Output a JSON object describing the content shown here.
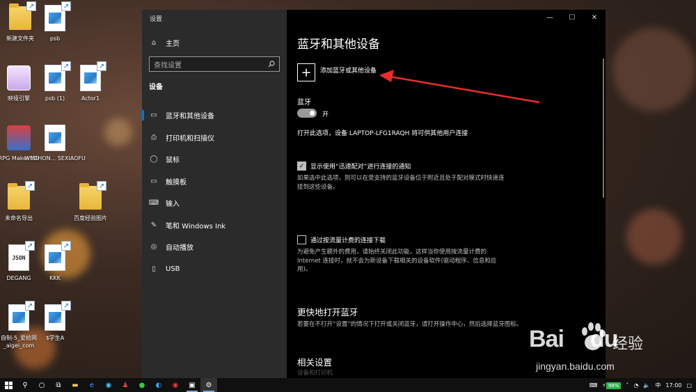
{
  "desktop": {
    "icons": [
      {
        "label": "新建文件夹",
        "icon": "folder-icon"
      },
      {
        "label": "psb",
        "icon": "image-file-icon"
      },
      {
        "label": "映境引擎",
        "icon": "app-icon"
      },
      {
        "label": "psb (1)",
        "icon": "image-file-icon"
      },
      {
        "label": "Actor1",
        "icon": "image-file-icon"
      },
      {
        "label": "RPG Maker MV",
        "icon": "rpg-maker-icon"
      },
      {
        "label": "WUZHON... SEXIAOFU",
        "icon": "image-file-icon"
      },
      {
        "label": "未命名导出",
        "icon": "folder-icon"
      },
      {
        "label": "百度经验图片",
        "icon": "folder-icon"
      },
      {
        "label": "DEGANG",
        "icon": "json-file-icon"
      },
      {
        "label": "KKK",
        "icon": "image-file-icon"
      },
      {
        "label": "自制-5_爱给网_algei_com",
        "icon": "image-file-icon"
      },
      {
        "label": "$学生A",
        "icon": "image-file-icon"
      }
    ],
    "json_badge": "JSON"
  },
  "window": {
    "title": "设置",
    "controls": {
      "minimize": "—",
      "maximize": "☐",
      "close": "✕"
    }
  },
  "sidebar": {
    "home": "主页",
    "search_placeholder": "查找设置",
    "section": "设备",
    "items": [
      {
        "label": "蓝牙和其他设备",
        "icon": "bluetooth-devices-icon"
      },
      {
        "label": "打印机和扫描仪",
        "icon": "printer-icon"
      },
      {
        "label": "鼠标",
        "icon": "mouse-icon"
      },
      {
        "label": "触摸板",
        "icon": "touchpad-icon"
      },
      {
        "label": "输入",
        "icon": "keyboard-icon"
      },
      {
        "label": "笔和 Windows Ink",
        "icon": "pen-icon"
      },
      {
        "label": "自动播放",
        "icon": "autoplay-icon"
      },
      {
        "label": "USB",
        "icon": "usb-icon"
      }
    ]
  },
  "main": {
    "title": "蓝牙和其他设备",
    "add_device": "添加蓝牙或其他设备",
    "bluetooth_heading": "蓝牙",
    "bluetooth_toggle_state": "开",
    "discoverable_text": "打开此选项，设备 LAPTOP-LFG1RAQH 将可供其他用户连接",
    "swift_pair_label": "显示使用“迅速配对”进行连接的通知",
    "swift_pair_checked": true,
    "swift_pair_desc": "如果选中此选项，则可以在受支持的蓝牙设备位于附近且处于配对模式时快速连接到这些设备。",
    "metered_label": "通过按流量计费的连接下载",
    "metered_checked": false,
    "metered_desc": "为避免产生额外的费用，请始终关闭此功能，这样当你使用按流量计费的 Internet 连接时，就不会为新设备下载相关的设备软件(驱动程序、信息和应用)。",
    "quick_bt_heading": "更快地打开蓝牙",
    "quick_bt_desc": "若要在不打开“设置”的情况下打开或关闭蓝牙，请打开操作中心，然后选择蓝牙图标。",
    "related_heading": "相关设置",
    "related_partial": "设备和打印机"
  },
  "watermark": {
    "brand": "Bai",
    "brand2": "du",
    "cn": "经验",
    "url": "jingyan.baidu.com"
  },
  "taskbar": {
    "battery": "98%",
    "ime": "中",
    "time": "17:00"
  },
  "colors": {
    "accent": "#0078d7",
    "arrow": "#e82d2d"
  }
}
